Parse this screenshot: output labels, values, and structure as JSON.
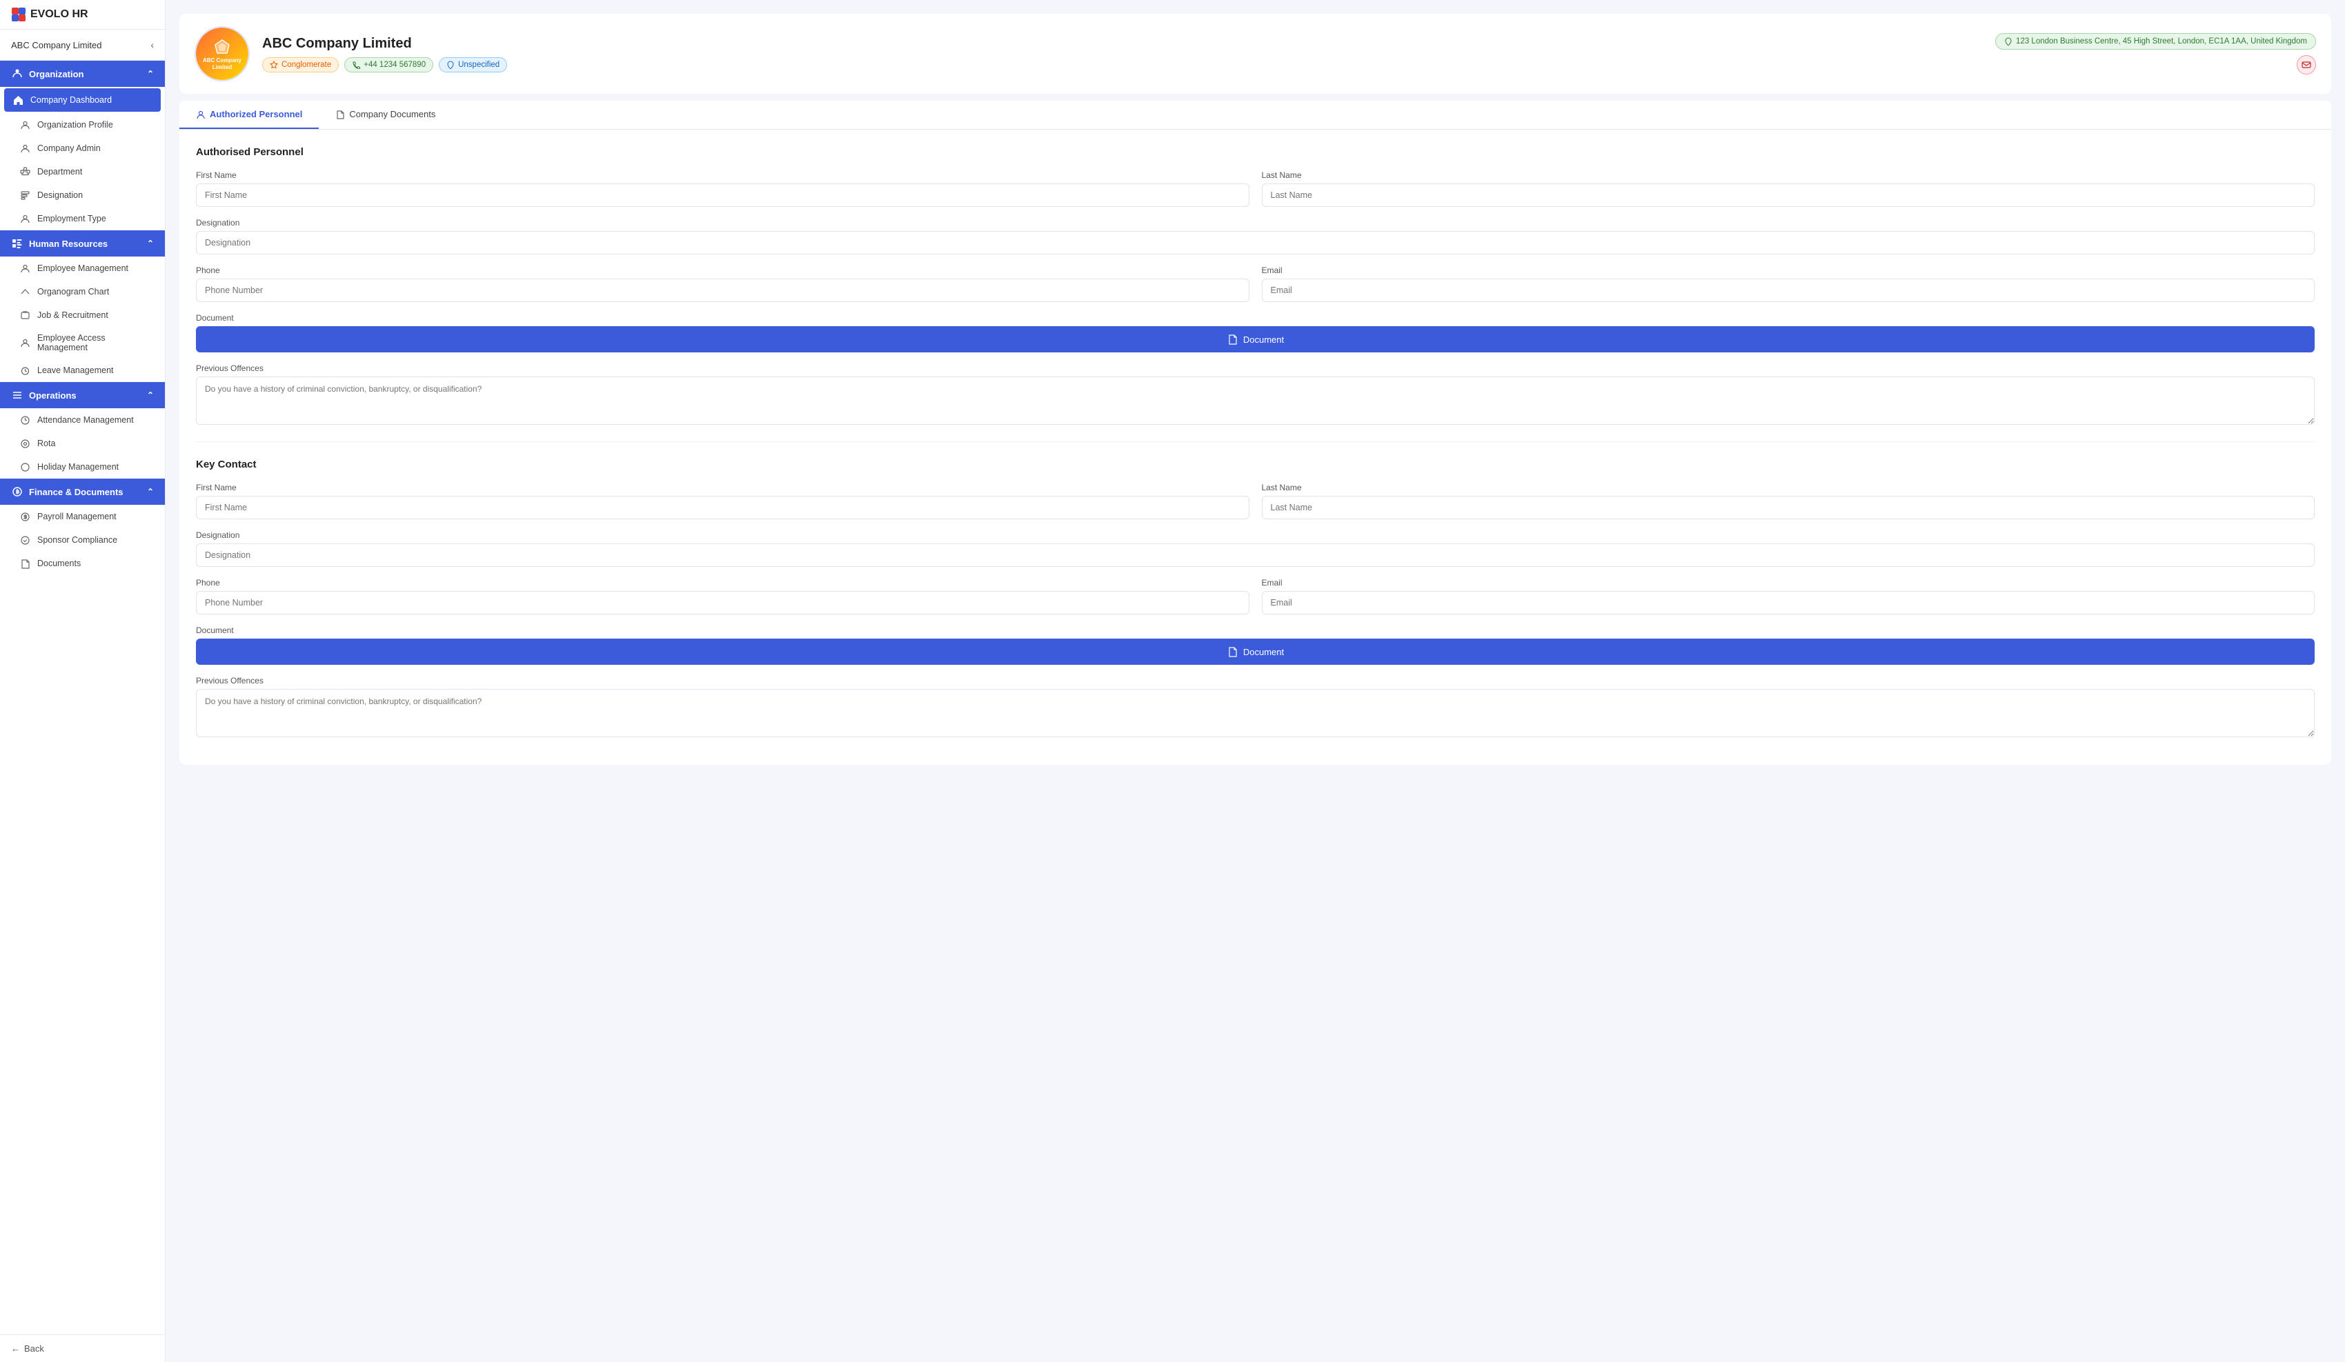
{
  "app": {
    "name": "EVOLO HR"
  },
  "sidebar": {
    "company_name": "ABC Company Limited",
    "sections": [
      {
        "id": "organization",
        "label": "Organization",
        "icon": "org-icon",
        "expanded": true,
        "items": [
          {
            "id": "company-dashboard",
            "label": "Company Dashboard",
            "active": true
          },
          {
            "id": "organization-profile",
            "label": "Organization Profile",
            "active": false
          },
          {
            "id": "company-admin",
            "label": "Company Admin",
            "active": false
          },
          {
            "id": "department",
            "label": "Department",
            "active": false
          },
          {
            "id": "designation",
            "label": "Designation",
            "active": false
          },
          {
            "id": "employment-type",
            "label": "Employment Type",
            "active": false
          }
        ]
      },
      {
        "id": "human-resources",
        "label": "Human Resources",
        "icon": "hr-icon",
        "expanded": true,
        "items": [
          {
            "id": "employee-management",
            "label": "Employee Management",
            "active": false
          },
          {
            "id": "organogram-chart",
            "label": "Organogram Chart",
            "active": false
          },
          {
            "id": "job-recruitment",
            "label": "Job & Recruitment",
            "active": false
          },
          {
            "id": "employee-access-management",
            "label": "Employee Access Management",
            "active": false
          },
          {
            "id": "leave-management",
            "label": "Leave Management",
            "active": false
          }
        ]
      },
      {
        "id": "operations",
        "label": "Operations",
        "icon": "ops-icon",
        "expanded": true,
        "items": [
          {
            "id": "attendance-management",
            "label": "Attendance Management",
            "active": false
          },
          {
            "id": "rota",
            "label": "Rota",
            "active": false
          },
          {
            "id": "holiday-management",
            "label": "Holiday Management",
            "active": false
          }
        ]
      },
      {
        "id": "finance-documents",
        "label": "Finance & Documents",
        "icon": "finance-icon",
        "expanded": true,
        "items": [
          {
            "id": "payroll-management",
            "label": "Payroll Management",
            "active": false
          },
          {
            "id": "sponsor-compliance",
            "label": "Sponsor Compliance",
            "active": false
          },
          {
            "id": "documents",
            "label": "Documents",
            "active": false
          }
        ]
      }
    ],
    "back_label": "Back"
  },
  "main": {
    "company": {
      "name": "ABC Company Limited",
      "type_badge": "Conglomerate",
      "phone": "+44 1234 567890",
      "location_badge": "Unspecified",
      "address": "123 London Business Centre, 45 High Street, London, EC1A 1AA, United Kingdom"
    },
    "tabs": [
      {
        "id": "authorized-personnel",
        "label": "Authorized Personnel",
        "active": true
      },
      {
        "id": "company-documents",
        "label": "Company Documents",
        "active": false
      }
    ],
    "authorized_personnel": {
      "title": "Authorised Personnel",
      "first_name_label": "First Name",
      "first_name_placeholder": "First Name",
      "last_name_label": "Last Name",
      "last_name_placeholder": "Last Name",
      "designation_label": "Designation",
      "designation_placeholder": "Designation",
      "phone_label": "Phone",
      "phone_placeholder": "Phone Number",
      "email_label": "Email",
      "email_placeholder": "Email",
      "document_label": "Document",
      "document_btn_label": "Document",
      "previous_offences_label": "Previous Offences",
      "previous_offences_placeholder": "Do you have a history of criminal conviction, bankruptcy, or disqualification?"
    },
    "key_contact": {
      "title": "Key Contact",
      "first_name_label": "First Name",
      "first_name_placeholder": "First Name",
      "last_name_label": "Last Name",
      "last_name_placeholder": "Last Name",
      "designation_label": "Designation",
      "designation_placeholder": "Designation",
      "phone_label": "Phone",
      "phone_placeholder": "Phone Number",
      "email_label": "Email",
      "email_placeholder": "Email",
      "document_label": "Document",
      "document_btn_label": "Document",
      "previous_offences_label": "Previous Offences",
      "previous_offences_placeholder": "Do you have a history of criminal conviction, bankruptcy, or disqualification?"
    }
  }
}
